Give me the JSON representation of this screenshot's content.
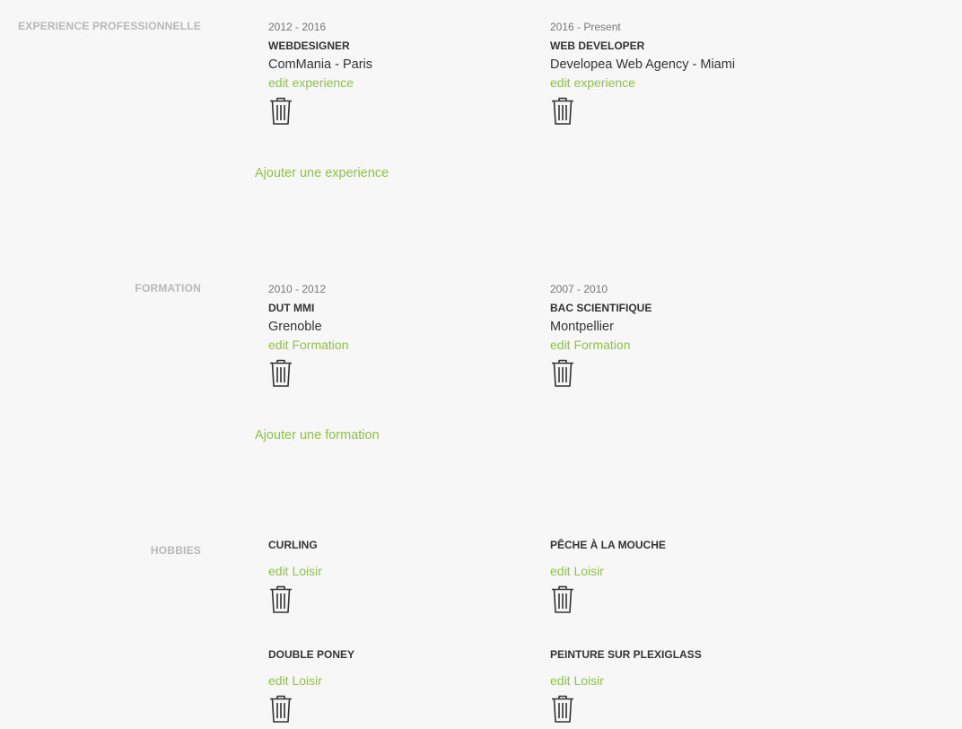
{
  "accent_color": "#8dc447",
  "experience": {
    "label": "EXPERIENCE PROFESSIONNELLE",
    "items": [
      {
        "dates": "2012 - 2016",
        "title": "WEBDESIGNER",
        "org": "ComMania - Paris",
        "edit_label": "edit experience",
        "delete_icon": "trash-icon"
      },
      {
        "dates": "2016 - Present",
        "title": "WEB DEVELOPER",
        "org": "Developea Web Agency - Miami",
        "edit_label": "edit experience",
        "delete_icon": "trash-icon"
      }
    ],
    "add_label": "Ajouter une experience"
  },
  "formation": {
    "label": "FORMATION",
    "items": [
      {
        "dates": "2010 - 2012",
        "title": "DUT MMI",
        "org": "Grenoble",
        "edit_label": "edit Formation",
        "delete_icon": "trash-icon"
      },
      {
        "dates": "2007 - 2010",
        "title": "BAC SCIENTIFIQUE",
        "org": "Montpellier",
        "edit_label": "edit Formation",
        "delete_icon": "trash-icon"
      }
    ],
    "add_label": "Ajouter une formation"
  },
  "hobbies": {
    "label": "HOBBIES",
    "items": [
      {
        "title": "CURLING",
        "edit_label": "edit Loisir",
        "delete_icon": "trash-icon"
      },
      {
        "title": "PÊCHE À LA MOUCHE",
        "edit_label": "edit Loisir",
        "delete_icon": "trash-icon"
      },
      {
        "title": "DOUBLE PONEY",
        "edit_label": "edit Loisir",
        "delete_icon": "trash-icon"
      },
      {
        "title": "PEINTURE SUR PLEXIGLASS",
        "edit_label": "edit Loisir",
        "delete_icon": "trash-icon"
      }
    ]
  }
}
